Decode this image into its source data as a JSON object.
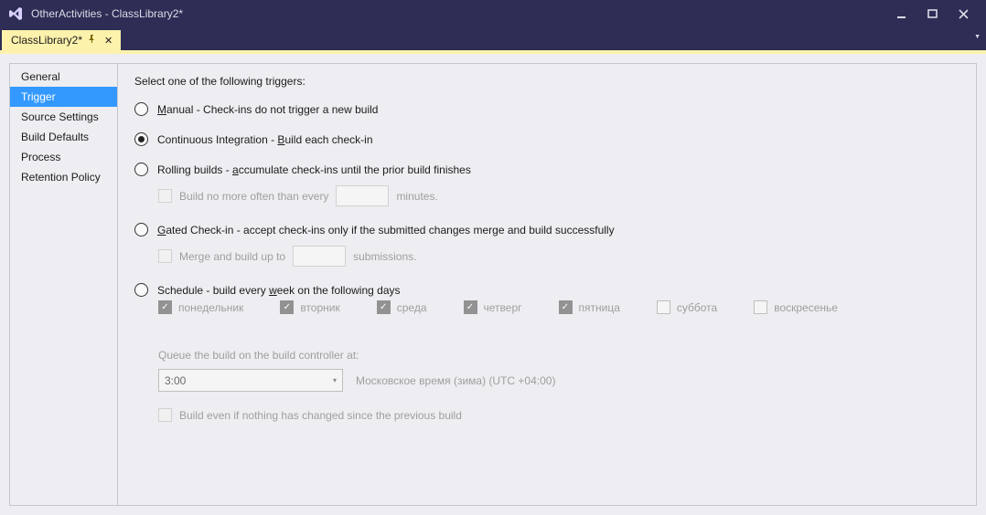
{
  "window": {
    "title": "OtherActivities - ClassLibrary2*"
  },
  "tab": {
    "label": "ClassLibrary2*"
  },
  "sidebar": {
    "items": [
      {
        "label": "General"
      },
      {
        "label": "Trigger"
      },
      {
        "label": "Source Settings"
      },
      {
        "label": "Build Defaults"
      },
      {
        "label": "Process"
      },
      {
        "label": "Retention Policy"
      }
    ],
    "selected_index": 1
  },
  "main": {
    "heading": "Select one of the following triggers:",
    "options": {
      "manual": {
        "pre": "",
        "u": "M",
        "post": "anual - Check-ins do not trigger a new build"
      },
      "ci": {
        "pre": "Continuous Integration - ",
        "u": "B",
        "post": "uild each check-in"
      },
      "rolling": {
        "pre": "Rolling builds - ",
        "u": "a",
        "post": "ccumulate check-ins until the prior build finishes",
        "sub_pre": "Build no more often than e",
        "sub_u": "v",
        "sub_mid": "ery",
        "sub_after": "minutes."
      },
      "gated": {
        "pre": "",
        "u": "G",
        "post": "ated Check-in - accept check-ins only if the submitted changes merge and build successfully",
        "sub_pre": "Merge and build up t",
        "sub_u": "o",
        "sub_after": "submissions."
      },
      "schedule": {
        "pre": "Schedule - build every ",
        "u": "w",
        "post": "eek on the following days"
      }
    },
    "days": [
      {
        "label": "понедельник",
        "checked": true
      },
      {
        "label": "вторник",
        "checked": true
      },
      {
        "label": "среда",
        "checked": true
      },
      {
        "label": "четверг",
        "checked": true
      },
      {
        "label": "пятница",
        "checked": true
      },
      {
        "label": "суббота",
        "checked": false
      },
      {
        "label": "воскресенье",
        "checked": false
      }
    ],
    "queue_label": "Queue the build on the build controller at:",
    "queue_time": "3:00",
    "queue_tz": "Московское время (зима) (UTC +04:00)",
    "build_even_pre": "Build e",
    "build_even_u": "v",
    "build_even_post": "en if nothing has changed since the previous build"
  }
}
